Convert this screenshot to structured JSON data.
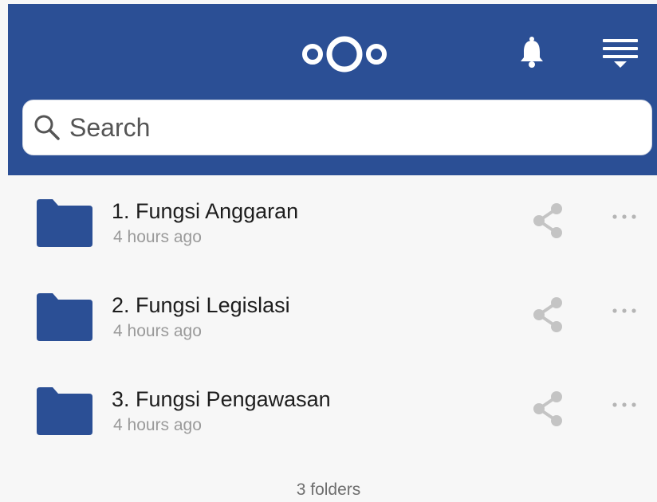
{
  "header": {
    "brand_icon": "nextcloud-logo",
    "bell_icon": "bell-icon",
    "menu_icon": "menu-icon",
    "color": "#2b4f95"
  },
  "search": {
    "placeholder": "Search",
    "value": ""
  },
  "files": [
    {
      "name": "1. Fungsi Anggaran",
      "modified": "4 hours ago",
      "type": "folder"
    },
    {
      "name": "2. Fungsi Legislasi",
      "modified": "4 hours ago",
      "type": "folder"
    },
    {
      "name": "3. Fungsi Pengawasan",
      "modified": "4 hours ago",
      "type": "folder"
    }
  ],
  "footer": {
    "summary": "3 folders"
  }
}
